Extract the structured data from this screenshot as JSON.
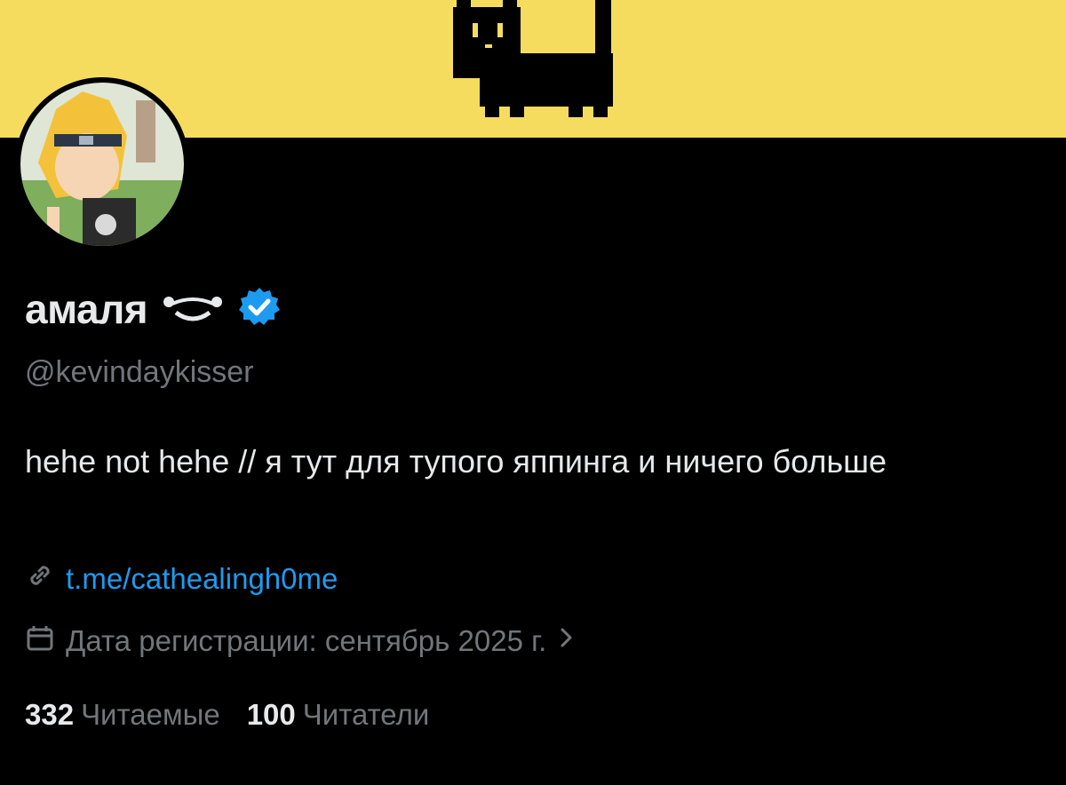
{
  "profile": {
    "display_name": "амаля",
    "handle": "@kevindaykisser",
    "bio": "hehe not hehe // я тут для тупого яппинга и ничего больше",
    "link": "t.me/cathealingh0me",
    "joined": "Дата регистрации: сентябрь 2025 г."
  },
  "stats": {
    "following_count": "332",
    "following_label": "Читаемые",
    "followers_count": "100",
    "followers_label": "Читатели"
  },
  "icons": {
    "verified": "verified-badge-icon",
    "link": "link-icon",
    "calendar": "calendar-icon",
    "chevron": "chevron-right-icon",
    "name_emoji": "face-emoji-icon"
  },
  "colors": {
    "banner": "#f6dc5e",
    "accent": "#1d9bf0",
    "secondary_text": "#71767b",
    "primary_text": "#e7e9ea"
  }
}
